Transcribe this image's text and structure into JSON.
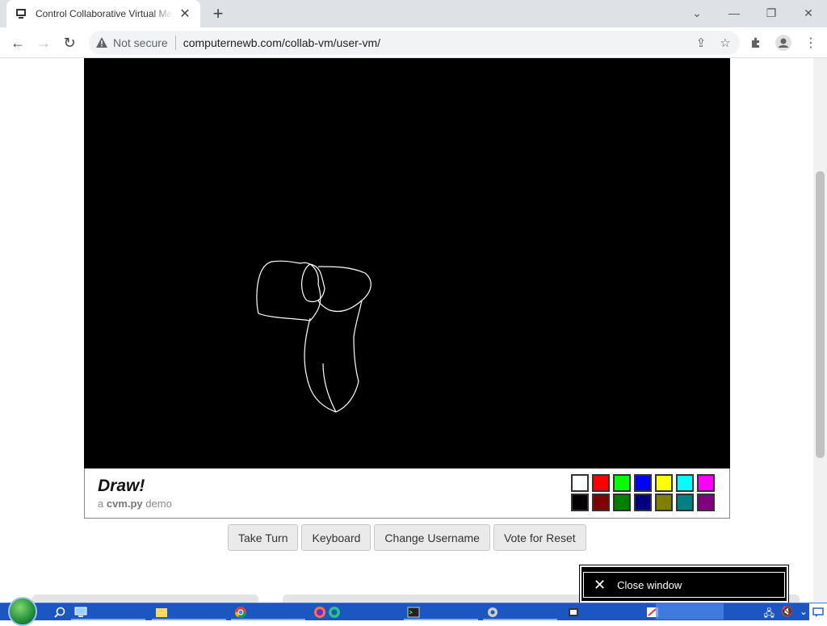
{
  "browser": {
    "tab_title": "Control Collaborative Virtual Machine",
    "url_security": "Not secure",
    "url": "computernewb.com/collab-vm/user-vm/"
  },
  "vm": {
    "draw_title": "Draw!",
    "draw_sub_prefix": "a",
    "draw_sub_brand": "cvm.py",
    "draw_sub_suffix": "demo",
    "palette": [
      "#ffffff",
      "#ff0000",
      "#00ff00",
      "#0000ff",
      "#ffff00",
      "#00ffff",
      "#ff00ff",
      "#000000",
      "#800000",
      "#008000",
      "#000080",
      "#808000",
      "#008080",
      "#800080"
    ]
  },
  "buttons": {
    "take_turn": "Take Turn",
    "keyboard": "Keyboard",
    "change_username": "Change Username",
    "vote_reset": "Vote for Reset"
  },
  "popup": {
    "close_window": "Close window"
  },
  "taskbar": {
    "items": [
      "search-icon",
      "computer-icon",
      "folder-icon",
      "chrome-icon",
      "firefox-icon",
      "edge-icon",
      "terminal-icon",
      "settings-icon",
      "app-icon",
      "paint-icon"
    ]
  }
}
